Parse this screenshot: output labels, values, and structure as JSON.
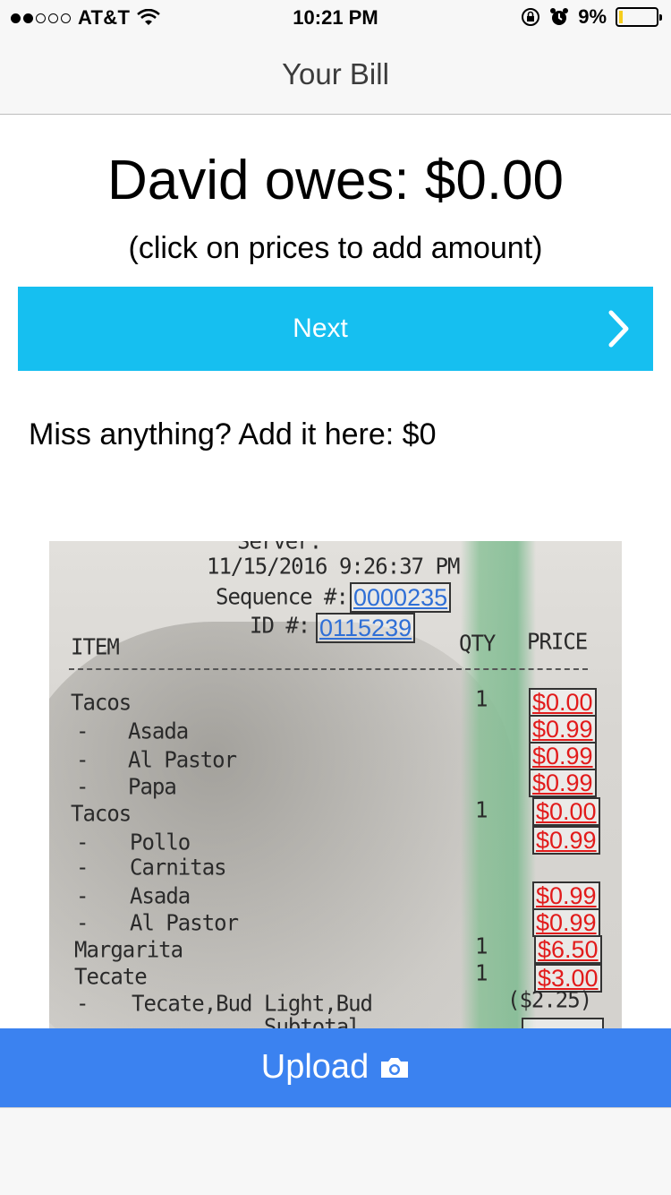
{
  "status_bar": {
    "carrier": "AT&T",
    "time": "10:21 PM",
    "battery": "9%",
    "battery_level": 0.09,
    "signal_dots_filled": 2,
    "signal_dots_total": 5
  },
  "nav": {
    "title": "Your Bill"
  },
  "summary": {
    "owes_text": "David owes: $0.00",
    "hint": "(click on prices to add amount)"
  },
  "next_button": {
    "label": "Next"
  },
  "missing": {
    "text": "Miss anything? Add it here: $0"
  },
  "receipt": {
    "server_line": "Server: ",
    "datetime": "11/15/2016 9:26:37 PM",
    "sequence_label": "Sequence #:",
    "sequence_value": "0000235",
    "id_label": "ID #:",
    "id_value": "0115239",
    "col_item": "ITEM",
    "col_qty": "QTY",
    "col_price": "PRICE",
    "lines": [
      {
        "dash": "",
        "name": "Tacos",
        "qty": "1",
        "price": "$0.00"
      },
      {
        "dash": "-",
        "name": "Asada",
        "qty": "",
        "price": "$0.99"
      },
      {
        "dash": "-",
        "name": "Al Pastor",
        "qty": "",
        "price": "$0.99"
      },
      {
        "dash": "-",
        "name": "Papa",
        "qty": "",
        "price": "$0.99"
      },
      {
        "dash": "",
        "name": "Tacos",
        "qty": "1",
        "price": "$0.00"
      },
      {
        "dash": "-",
        "name": "Pollo",
        "qty": "",
        "price": "$0.99"
      },
      {
        "dash": "-",
        "name": "Carnitas",
        "qty": "",
        "price": ""
      },
      {
        "dash": "-",
        "name": "Asada",
        "qty": "",
        "price": "$0.99"
      },
      {
        "dash": "-",
        "name": "Al Pastor",
        "qty": "",
        "price": "$0.99"
      },
      {
        "dash": "",
        "name": "Margarita",
        "qty": "1",
        "price": "$6.50"
      },
      {
        "dash": "",
        "name": "Tecate",
        "qty": "1",
        "price": "$3.00"
      },
      {
        "dash": "-",
        "name": "Tecate,Bud Light,Bud",
        "qty": "",
        "price": ""
      }
    ],
    "discount_text": "($2.25)",
    "subtotal_label": "Subtotal"
  },
  "upload_button": {
    "label": "Upload",
    "icon": "camera-icon"
  },
  "colors": {
    "next_bg": "#16bff0",
    "upload_bg": "#3b82f0",
    "price_text": "#e21b1b",
    "link_text": "#2f6fd6"
  }
}
